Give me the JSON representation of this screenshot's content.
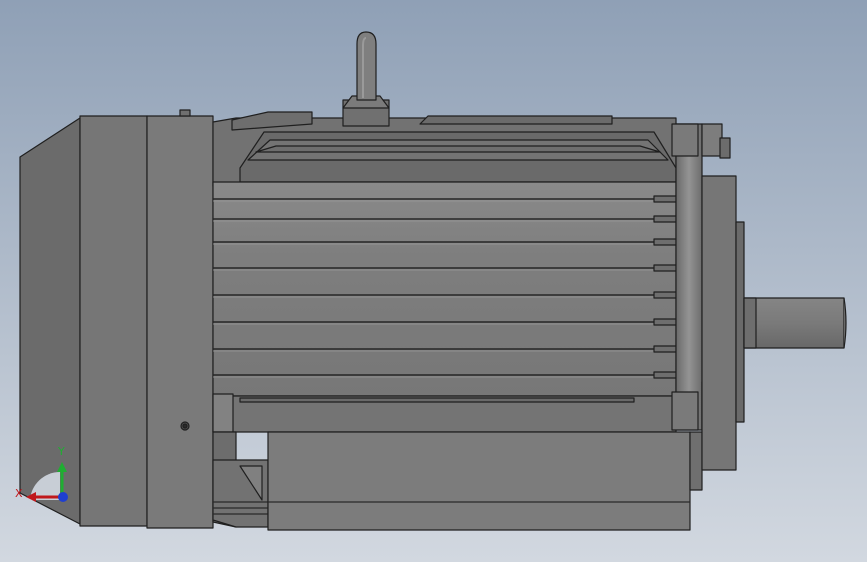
{
  "viewport": {
    "background_top": "#8fa0b6",
    "background_bottom": "#d2d8e0"
  },
  "triad": {
    "x_label": "X",
    "y_label": "Y",
    "x_color": "#c0181c",
    "y_color": "#1fae32",
    "z_color": "#1f3fd0"
  }
}
